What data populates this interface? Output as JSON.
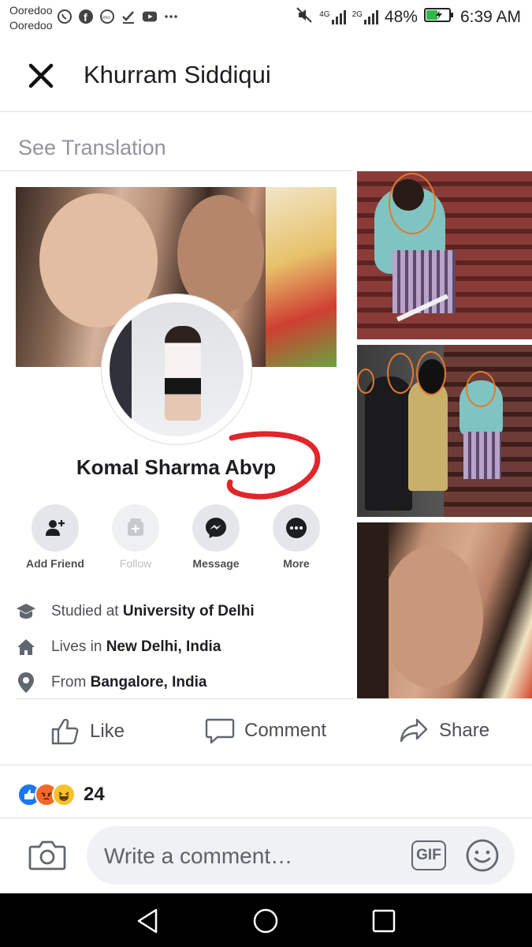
{
  "status_bar": {
    "carrier_1": "Ooredoo",
    "carrier_2": "Ooredoo",
    "left_icons": [
      "whatsapp-icon",
      "facebook-icon",
      "imo-icon",
      "check-icon",
      "youtube-icon",
      "more-dots-icon"
    ],
    "network_1": "4G",
    "network_2": "2G",
    "battery": "48%",
    "time": "6:39 AM"
  },
  "header": {
    "title": "Khurram Siddiqui"
  },
  "post": {
    "see_translation": "See Translation"
  },
  "profile": {
    "name": "Komal Sharma Abvp",
    "actions": [
      {
        "label": "Add Friend",
        "icon": "add-friend-icon",
        "enabled": true
      },
      {
        "label": "Follow",
        "icon": "follow-icon",
        "enabled": false
      },
      {
        "label": "Message",
        "icon": "messenger-icon",
        "enabled": true
      },
      {
        "label": "More",
        "icon": "more-icon",
        "enabled": true
      }
    ],
    "about": [
      {
        "icon": "education-icon",
        "prefix": "Studied at ",
        "value": "University of Delhi"
      },
      {
        "icon": "home-icon",
        "prefix": "Lives in ",
        "value": "New Delhi, India"
      },
      {
        "icon": "location-icon",
        "prefix": "From ",
        "value": "Bangalore, India"
      }
    ]
  },
  "post_actions": {
    "like": "Like",
    "comment": "Comment",
    "share": "Share"
  },
  "reactions": {
    "types": [
      "like",
      "angry",
      "haha"
    ],
    "count": "24"
  },
  "comment_bar": {
    "placeholder": "Write a comment…",
    "gif_label": "GIF"
  },
  "colors": {
    "facebook_blue": "#1877f2",
    "text_dark": "#1c1e21",
    "text_muted": "#4b4f56",
    "annotation_red": "#e0262b"
  }
}
